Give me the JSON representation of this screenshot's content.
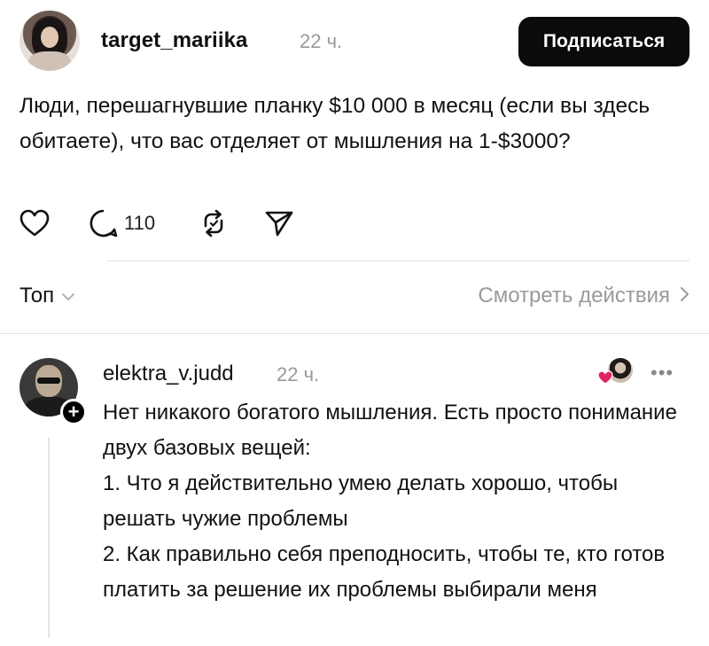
{
  "post": {
    "username": "target_mariika",
    "time": "22 ч.",
    "follow_label": "Подписаться",
    "text": "Люди, перешагнувшие планку $10 000 в месяц (если вы здесь обитаете), что вас отделяет от мышления на 1-$3000?",
    "reply_count": "110"
  },
  "sort": {
    "label": "Топ",
    "view_activity": "Смотреть действия"
  },
  "reply": {
    "username": "elektra_v.judd",
    "time": "22 ч.",
    "more": "•••",
    "lines": [
      "Нет никакого богатого мышления. Есть просто понимание двух базовых вещей:",
      "1. Что я действительно умею делать хорошо, чтобы решать чужие проблемы",
      "2. Как правильно себя преподносить, чтобы те, кто готов платить за решение их проблемы выбирали меня"
    ]
  },
  "icons": {
    "like": "heart-icon",
    "reply": "comment-icon",
    "repost": "repost-icon",
    "share": "send-icon",
    "sort_chevron": "chevron-down-icon",
    "activity_chevron": "chevron-right-icon",
    "liked_heart": "heart-filled-icon"
  },
  "colors": {
    "text": "#111111",
    "secondary": "#9a9a9a",
    "button_bg": "#0b0b0b",
    "divider": "#e3e3e3",
    "liked_heart": "#e0245e"
  }
}
